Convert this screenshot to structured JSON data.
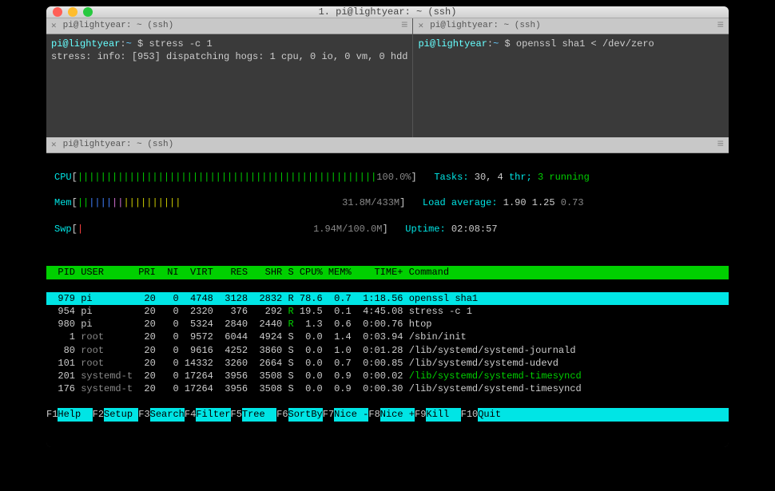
{
  "window": {
    "title": "1. pi@lightyear: ~ (ssh)"
  },
  "tabs": {
    "left": "pi@lightyear: ~ (ssh)",
    "right": "pi@lightyear: ~ (ssh)",
    "bottom": "pi@lightyear: ~ (ssh)"
  },
  "term_left": {
    "prompt_user": "pi@lightyear",
    "prompt_path": "~",
    "dollar": "$",
    "command": "stress -c 1",
    "output": "stress: info: [953] dispatching hogs: 1 cpu, 0 io, 0 vm, 0 hdd"
  },
  "term_right": {
    "prompt_user": "pi@lightyear",
    "prompt_path": "~",
    "dollar": "$",
    "command": "openssl sha1 < /dev/zero"
  },
  "htop": {
    "meters": {
      "cpu_label": "CPU",
      "cpu_pct": "100.0%",
      "mem_label": "Mem",
      "mem_val": "31.8M/433M",
      "swp_label": "Swp",
      "swp_val": "1.94M/100.0M"
    },
    "stats": {
      "tasks_label": "Tasks:",
      "tasks_vals": "30, 4",
      "tasks_thr": "thr;",
      "tasks_running": "3",
      "running_word": "running",
      "load_label": "Load average:",
      "load1": "1.90",
      "load2": "1.25",
      "load3": "0.73",
      "uptime_label": "Uptime:",
      "uptime_val": "02:08:57"
    },
    "header": {
      "pid": "PID",
      "user": "USER",
      "pri": "PRI",
      "ni": "NI",
      "virt": "VIRT",
      "res": "RES",
      "shr": "SHR",
      "s": "S",
      "cpu": "CPU%",
      "mem": "MEM%",
      "time": "TIME+",
      "cmd": "Command"
    },
    "rows": [
      {
        "pid": "979",
        "user": "pi",
        "pri": "20",
        "ni": "0",
        "virt": "4748",
        "res": "3128",
        "shr": "2832",
        "s": "R",
        "cpu": "78.6",
        "mem": "0.7",
        "time": "1:18.56",
        "cmd": "openssl sha1",
        "hl": true
      },
      {
        "pid": "954",
        "user": "pi",
        "pri": "20",
        "ni": "0",
        "virt": "2320",
        "res": "376",
        "shr": "292",
        "s": "R",
        "cpu": "19.5",
        "mem": "0.1",
        "time": "4:45.08",
        "cmd": "stress -c 1"
      },
      {
        "pid": "980",
        "user": "pi",
        "pri": "20",
        "ni": "0",
        "virt": "5324",
        "res": "2840",
        "shr": "2440",
        "s": "R",
        "cpu": "1.3",
        "mem": "0.6",
        "time": "0:00.76",
        "cmd": "htop"
      },
      {
        "pid": "1",
        "user": "root",
        "pri": "20",
        "ni": "0",
        "virt": "9572",
        "res": "6044",
        "shr": "4924",
        "s": "S",
        "cpu": "0.0",
        "mem": "1.4",
        "time": "0:03.94",
        "cmd": "/sbin/init"
      },
      {
        "pid": "80",
        "user": "root",
        "pri": "20",
        "ni": "0",
        "virt": "9616",
        "res": "4252",
        "shr": "3860",
        "s": "S",
        "cpu": "0.0",
        "mem": "1.0",
        "time": "0:01.28",
        "cmd": "/lib/systemd/systemd-journald"
      },
      {
        "pid": "101",
        "user": "root",
        "pri": "20",
        "ni": "0",
        "virt": "14332",
        "res": "3260",
        "shr": "2664",
        "s": "S",
        "cpu": "0.0",
        "mem": "0.7",
        "time": "0:00.85",
        "cmd": "/lib/systemd/systemd-udevd"
      },
      {
        "pid": "201",
        "user": "systemd-t",
        "pri": "20",
        "ni": "0",
        "virt": "17264",
        "res": "3956",
        "shr": "3508",
        "s": "S",
        "cpu": "0.0",
        "mem": "0.9",
        "time": "0:00.02",
        "cmd": "/lib/systemd/systemd-timesyncd",
        "green": true
      },
      {
        "pid": "176",
        "user": "systemd-t",
        "pri": "20",
        "ni": "0",
        "virt": "17264",
        "res": "3956",
        "shr": "3508",
        "s": "S",
        "cpu": "0.0",
        "mem": "0.9",
        "time": "0:00.30",
        "cmd": "/lib/systemd/systemd-timesyncd"
      }
    ],
    "fkeys": [
      {
        "k": "F1",
        "l": "Help  "
      },
      {
        "k": "F2",
        "l": "Setup "
      },
      {
        "k": "F3",
        "l": "Search"
      },
      {
        "k": "F4",
        "l": "Filter"
      },
      {
        "k": "F5",
        "l": "Tree  "
      },
      {
        "k": "F6",
        "l": "SortBy"
      },
      {
        "k": "F7",
        "l": "Nice -"
      },
      {
        "k": "F8",
        "l": "Nice +"
      },
      {
        "k": "F9",
        "l": "Kill  "
      },
      {
        "k": "F10",
        "l": "Quit"
      }
    ]
  }
}
